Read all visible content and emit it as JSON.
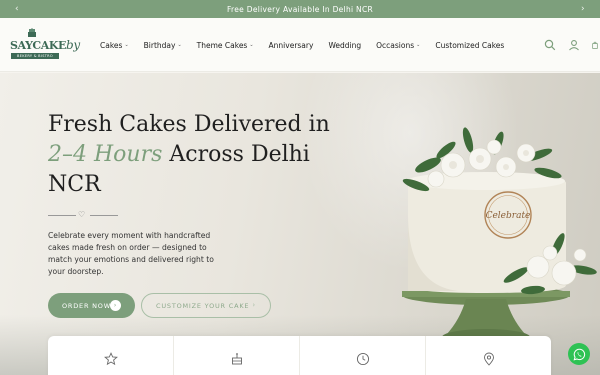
{
  "announcement": {
    "text": "Free Delivery Available In Delhi NCR"
  },
  "logo": {
    "brand": "SAYCAKE",
    "brand_script": "by",
    "tagline": "BEKERY & BISTRO"
  },
  "nav": {
    "items": [
      {
        "label": "Cakes",
        "has_dropdown": true
      },
      {
        "label": "Birthday",
        "has_dropdown": true
      },
      {
        "label": "Theme Cakes",
        "has_dropdown": true
      },
      {
        "label": "Anniversary",
        "has_dropdown": false
      },
      {
        "label": "Wedding",
        "has_dropdown": false
      },
      {
        "label": "Occasions",
        "has_dropdown": true
      },
      {
        "label": "Customized Cakes",
        "has_dropdown": false
      }
    ]
  },
  "header_icons": [
    "search-icon",
    "account-icon",
    "cart-icon"
  ],
  "hero": {
    "title_line1": "Fresh Cakes Delivered in",
    "title_accent": "2–4 Hours",
    "title_line2_rest": " Across Delhi",
    "title_line3": "NCR",
    "description": "Celebrate every moment with handcrafted cakes made fresh on order — designed to match your emotions and delivered right to your doorstep.",
    "order_button": "ORDER NOW",
    "customize_button": "CUSTOMIZE YOUR CAKE",
    "cake_topper_text": "Celebrate"
  },
  "features": [
    "star-icon",
    "cake-icon",
    "clock-icon",
    "location-icon"
  ],
  "colors": {
    "accent": "#7d9f7c",
    "whatsapp": "#2ec254"
  }
}
